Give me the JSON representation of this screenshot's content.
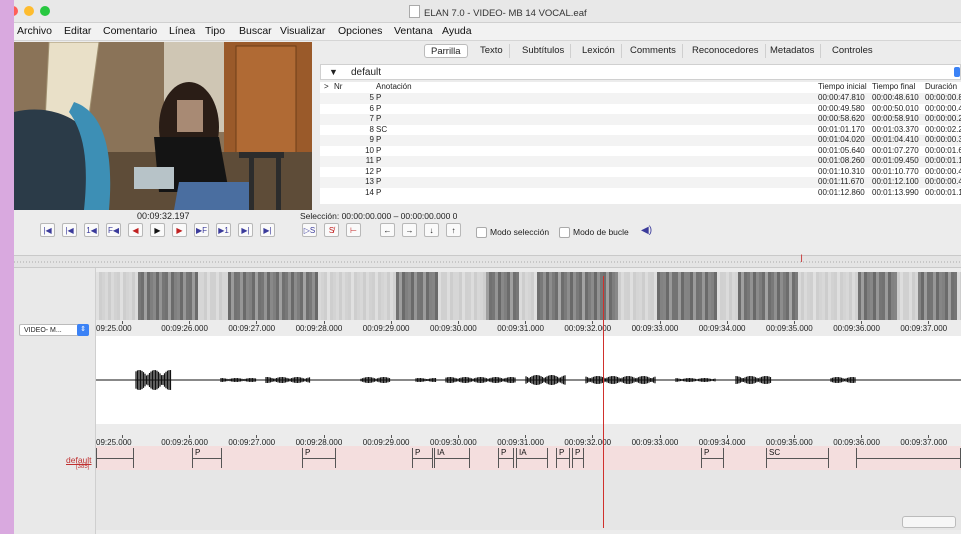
{
  "window": {
    "title": "ELAN 7.0 - VIDEO- MB 14 VOCAL.eaf",
    "controls": {
      "close_color": "#ff5f57",
      "minimize_color": "#febc2e",
      "maximize_color": "#28c840"
    }
  },
  "menu": [
    "Archivo",
    "Editar",
    "Comentario",
    "Línea",
    "Tipo",
    "Buscar",
    "Visualizar",
    "Opciones",
    "Ventana",
    "Ayuda"
  ],
  "player": {
    "time": "00:09:32.197",
    "selection": "Selección: 00:00:00.000 – 00:00:00.000  0",
    "mode_selection_label": "Modo selección",
    "loop_mode_label": "Modo de bucle"
  },
  "tabs": [
    {
      "label": "Parrilla",
      "active": true
    },
    {
      "label": "Texto"
    },
    {
      "label": "Subtítulos"
    },
    {
      "label": "Lexicón"
    },
    {
      "label": "Comments"
    },
    {
      "label": "Reconocedores"
    },
    {
      "label": "Metadatos"
    },
    {
      "label": "Controles"
    }
  ],
  "grid": {
    "tier_selected": "default",
    "headers": {
      "sort": ">",
      "nr": "Nr",
      "annotation": "Anotación",
      "start": "Tiempo inicial",
      "end": "Tiempo final",
      "duration": "Duración"
    },
    "rows": [
      {
        "nr": "5",
        "annotation": "P",
        "start": "00:00:47.810",
        "end": "00:00:48.610",
        "duration": "00:00:00.800"
      },
      {
        "nr": "6",
        "annotation": "P",
        "start": "00:00:49.580",
        "end": "00:00:50.010",
        "duration": "00:00:00.430"
      },
      {
        "nr": "7",
        "annotation": "P",
        "start": "00:00:58.620",
        "end": "00:00:58.910",
        "duration": "00:00:00.290"
      },
      {
        "nr": "8",
        "annotation": "SC",
        "start": "00:01:01.170",
        "end": "00:01:03.370",
        "duration": "00:00:02.200"
      },
      {
        "nr": "9",
        "annotation": "P",
        "start": "00:01:04.020",
        "end": "00:01:04.410",
        "duration": "00:00:00.390"
      },
      {
        "nr": "10",
        "annotation": "P",
        "start": "00:01:05.640",
        "end": "00:01:07.270",
        "duration": "00:00:01.630"
      },
      {
        "nr": "11",
        "annotation": "P",
        "start": "00:01:08.260",
        "end": "00:01:09.450",
        "duration": "00:00:01.190"
      },
      {
        "nr": "12",
        "annotation": "P",
        "start": "00:01:10.310",
        "end": "00:01:10.770",
        "duration": "00:00:00.460"
      },
      {
        "nr": "13",
        "annotation": "P",
        "start": "00:01:11.670",
        "end": "00:01:12.100",
        "duration": "00:00:00.430"
      },
      {
        "nr": "14",
        "annotation": "P",
        "start": "00:01:12.860",
        "end": "00:01:13.990",
        "duration": "00:00:01.130"
      }
    ]
  },
  "timeline": {
    "labels": [
      "09:25.000",
      "00:09:26.000",
      "00:09:27.000",
      "00:09:28.000",
      "00:09:29.000",
      "00:09:30.000",
      "00:09:31.000",
      "00:09:32.000",
      "00:09:33.000",
      "00:09:34.000",
      "00:09:35.000",
      "00:09:36.000",
      "00:09:37.000",
      "00"
    ],
    "video_track": "VIDEO- M...",
    "tier_name": "default",
    "tier_count": "[385]",
    "segments": [
      "",
      "P",
      "",
      "P",
      "",
      "P",
      "IA",
      "P",
      "IA",
      "P",
      "",
      "P",
      "",
      "P",
      "",
      "SC"
    ]
  },
  "colors": {
    "cursor": "#d0302c",
    "tier_label": "#c03030",
    "annotation_bg": "#f4dede",
    "accent": "#3b82f6"
  }
}
